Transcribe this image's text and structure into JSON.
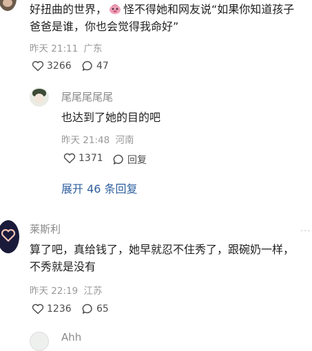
{
  "comment1": {
    "text_line1_before": "好扭曲的世界，",
    "text_line1_after": "怪不得她和网友说“如果你知道孩子",
    "text_line2": "爸爸是谁，你也会觉得我命好”",
    "time": "昨天 21:11",
    "location": "广东",
    "likes": "3266",
    "replies": "47"
  },
  "reply1": {
    "author": "尾尾尾尾尾",
    "text": "也达到了她的目的吧",
    "time": "昨天 21:48",
    "location": "河南",
    "likes": "1371",
    "reply_label": "回复",
    "expand_label": "展开 46 条回复"
  },
  "comment2": {
    "author": "莱斯利",
    "text_line1": "算了吧，真给钱了，她早就忍不住秀了，跟碗奶一样，",
    "text_line2": "不秀就是没有",
    "time": "昨天 22:19",
    "location": "江苏",
    "likes": "1236",
    "replies": "65",
    "more": "..."
  },
  "comment3": {
    "author": "Ahh"
  },
  "icons": {
    "like": "heart-outline-icon",
    "reply": "speech-bubble-icon",
    "more": "more-dots-icon"
  }
}
